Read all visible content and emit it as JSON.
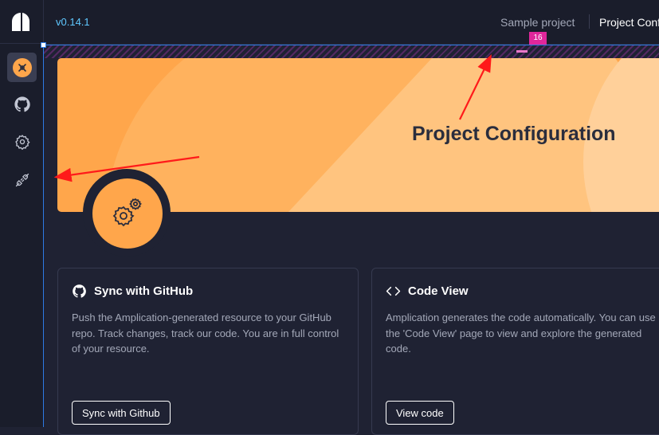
{
  "header": {
    "version": "v0.14.1",
    "breadcrumbs": [
      "Sample project",
      "Project Conf"
    ]
  },
  "sidebar": {
    "items": [
      {
        "name": "resource",
        "icon": "resource-icon",
        "active": true
      },
      {
        "name": "github",
        "icon": "github-icon",
        "active": false
      },
      {
        "name": "settings",
        "icon": "settings-icon",
        "active": false
      },
      {
        "name": "connections",
        "icon": "plug-icon",
        "active": false
      }
    ]
  },
  "overlay": {
    "spacing_badge": "16"
  },
  "banner": {
    "title": "Project Configuration"
  },
  "cards": [
    {
      "icon": "github-icon",
      "title": "Sync with GitHub",
      "body": "Push the Amplication-generated resource to your GitHub repo. Track changes, track our code. You are in full control of your resource.",
      "button": "Sync with Github"
    },
    {
      "icon": "code-icon",
      "title": "Code View",
      "body": "Amplication generates the code automatically. You can use the 'Code View' page to view and explore the generated code.",
      "button": "View code"
    }
  ],
  "colors": {
    "background": "#1f2233",
    "sidebar": "#1a1d2b",
    "accent": "#ffa64b",
    "version": "#5fc8ff",
    "annotation_arrow": "#ff1a1a",
    "selection": "#2d7be5",
    "spacing_badge": "#e0279b"
  }
}
